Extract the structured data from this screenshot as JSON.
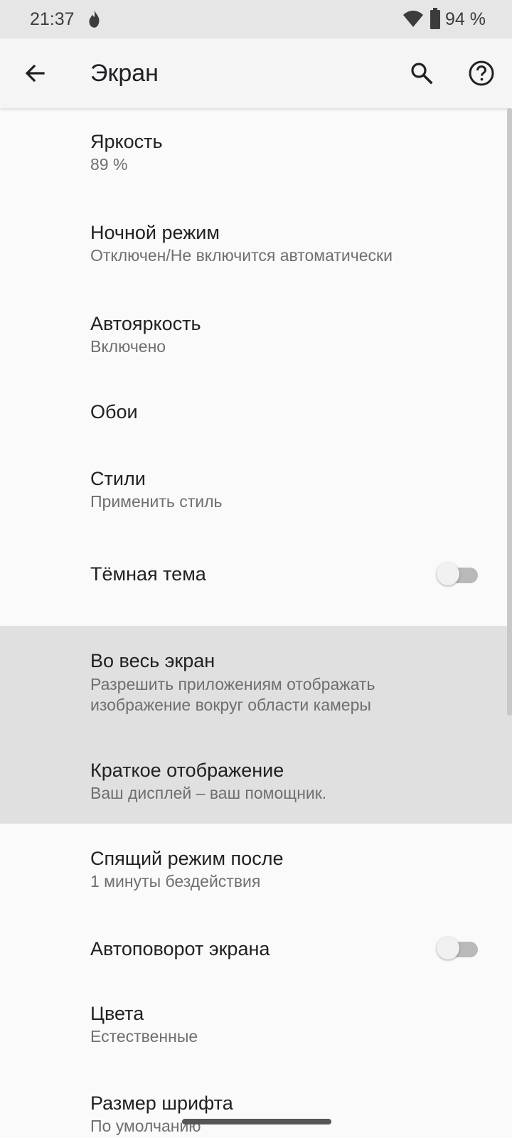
{
  "status_bar": {
    "time": "21:37",
    "battery": "94 %",
    "icons": [
      "flame-icon",
      "wifi-icon",
      "battery-icon"
    ]
  },
  "toolbar": {
    "title": "Экран",
    "icons": [
      "back-arrow-icon",
      "search-icon",
      "help-icon"
    ]
  },
  "settings": [
    {
      "title": "Яркость",
      "subtitle": "89 %"
    },
    {
      "title": "Ночной режим",
      "subtitle": "Отключен/Не включится автоматически"
    },
    {
      "title": "Автояркость",
      "subtitle": "Включено"
    },
    {
      "title": "Обои"
    },
    {
      "title": "Стили",
      "subtitle": "Применить стиль"
    },
    {
      "title": "Тёмная тема",
      "toggle": false
    },
    {
      "title": "Во весь экран",
      "subtitle_line1": "Разрешить приложениям отображать",
      "subtitle_line2": "изображение вокруг области камеры"
    },
    {
      "title": "Краткое отображение",
      "subtitle": "Ваш дисплей – ваш помощник."
    },
    {
      "title": "Спящий режим после",
      "subtitle": "1 минуты бездействия"
    },
    {
      "title": "Автоповорот экрана",
      "toggle": false
    },
    {
      "title": "Цвета",
      "subtitle": "Естественные"
    },
    {
      "title": "Размер шрифта",
      "subtitle": "По умолчанию"
    }
  ],
  "colors": {
    "background": "#fafafa",
    "toolbar": "#f5f5f5",
    "highlight": "#e0e0e0",
    "text_primary": "#202124",
    "text_secondary": "#6f6f6f"
  }
}
